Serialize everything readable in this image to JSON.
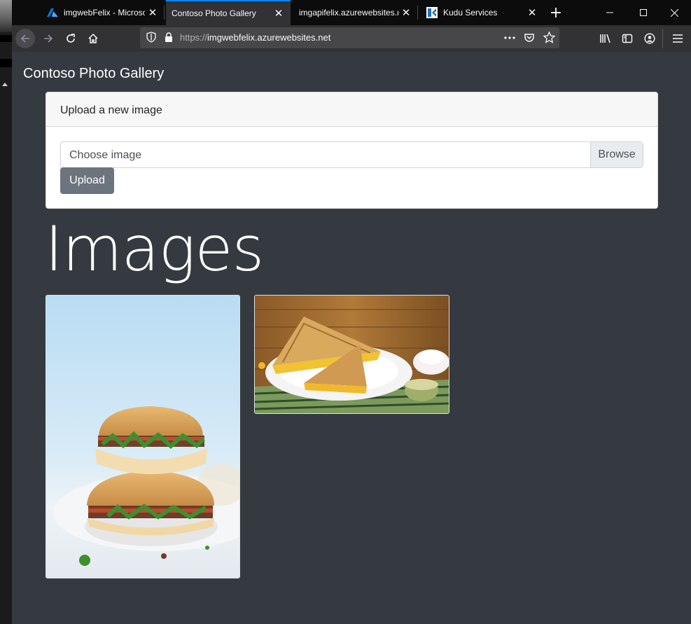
{
  "browser": {
    "tabs": [
      {
        "title": "imgwebFelix - Microsoft Azure",
        "favicon": "azure-icon",
        "active": false
      },
      {
        "title": "Contoso Photo Gallery",
        "favicon": "none",
        "active": true
      },
      {
        "title": "imgapifelix.azurewebsites.net",
        "favicon": "none",
        "active": false
      },
      {
        "title": "Kudu Services",
        "favicon": "kudu-icon",
        "active": false
      }
    ],
    "url_scheme": "https://",
    "url_host": "imgwebfelix.azurewebsites.net",
    "accent_color": "#0a84ff"
  },
  "page": {
    "brand": "Contoso Photo Gallery",
    "upload_card": {
      "header": "Upload a new image",
      "file_placeholder": "Choose image",
      "browse_label": "Browse",
      "upload_label": "Upload"
    },
    "images_heading": "Images",
    "images": [
      {
        "name": "banh-mi-sandwich",
        "description": "stacked sandwich on blue background"
      },
      {
        "name": "grilled-sandwich",
        "description": "grilled toasted sandwich on plate"
      }
    ]
  },
  "colors": {
    "page_bg": "#343a40",
    "button_secondary": "#6c757d",
    "card_header_bg": "#f7f7f7"
  }
}
